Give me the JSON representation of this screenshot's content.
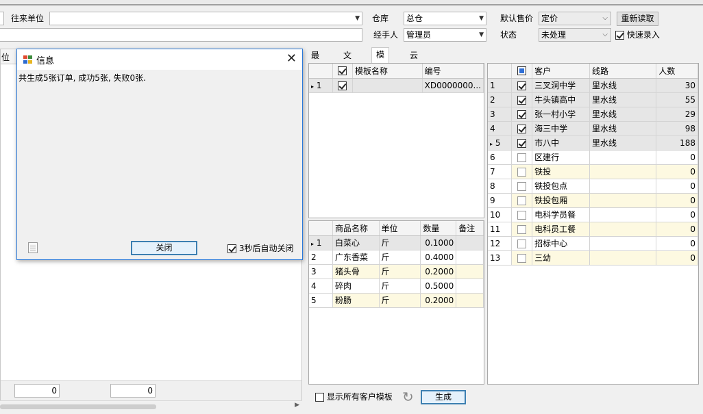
{
  "toolbar": {
    "counterparty_label": "往来单位",
    "counterparty_value": "",
    "warehouse_label": "仓库",
    "warehouse_value": "总仓",
    "default_price_label": "默认售价",
    "default_price_value": "定价",
    "reload_button": "重新读取",
    "handler_label": "经手人",
    "handler_value": "管理员",
    "status_label": "状态",
    "status_value": "未处理",
    "quick_entry_label": "快速录入",
    "quick_entry_checked": true,
    "left_partial_label": "位"
  },
  "dialog": {
    "title": "信息",
    "message": "共生成5张订单, 成功5张, 失败0张.",
    "close_button": "关闭",
    "auto_close_label": "3秒后自动关闭",
    "auto_close_checked": true
  },
  "left_panel": {
    "total_1": "0",
    "total_2": "0"
  },
  "tabs": [
    "最近",
    "文件",
    "模板",
    "云订单"
  ],
  "selected_tab": "模板",
  "templates": {
    "headers": [
      "模板名称",
      "编号"
    ],
    "rows": [
      {
        "indicator": "▸",
        "index": "1",
        "checked": true,
        "name": "",
        "code": "XD0000000..."
      }
    ]
  },
  "products": {
    "headers": [
      "商品名称",
      "单位",
      "数量",
      "备注"
    ],
    "rows": [
      {
        "index": "1",
        "name": "白菜心",
        "unit": "斤",
        "qty": "0.1000",
        "note": ""
      },
      {
        "index": "2",
        "name": "广东香菜",
        "unit": "斤",
        "qty": "0.4000",
        "note": ""
      },
      {
        "index": "3",
        "name": "猪头骨",
        "unit": "斤",
        "qty": "0.2000",
        "note": ""
      },
      {
        "index": "4",
        "name": "碎肉",
        "unit": "斤",
        "qty": "0.5000",
        "note": ""
      },
      {
        "index": "5",
        "name": "粉肠",
        "unit": "斤",
        "qty": "0.2000",
        "note": ""
      }
    ]
  },
  "customers": {
    "headers": [
      "客户",
      "线路",
      "人数"
    ],
    "rows": [
      {
        "index": "1",
        "checked": true,
        "name": "三叉洞中学",
        "route": "里水线",
        "count": "30"
      },
      {
        "index": "2",
        "checked": true,
        "name": "牛头镇高中",
        "route": "里水线",
        "count": "55"
      },
      {
        "index": "3",
        "checked": true,
        "name": "张一村小学",
        "route": "里水线",
        "count": "29"
      },
      {
        "index": "4",
        "checked": true,
        "name": "海三中学",
        "route": "里水线",
        "count": "98"
      },
      {
        "index": "5",
        "checked": true,
        "name": "市八中",
        "route": "里水线",
        "count": "188"
      },
      {
        "index": "6",
        "checked": false,
        "name": "区建行",
        "route": "",
        "count": "0"
      },
      {
        "index": "7",
        "checked": false,
        "name": "铁投",
        "route": "",
        "count": "0"
      },
      {
        "index": "8",
        "checked": false,
        "name": "铁投包点",
        "route": "",
        "count": "0"
      },
      {
        "index": "9",
        "checked": false,
        "name": "铁投包厢",
        "route": "",
        "count": "0"
      },
      {
        "index": "10",
        "checked": false,
        "name": "电科学员餐",
        "route": "",
        "count": "0"
      },
      {
        "index": "11",
        "checked": false,
        "name": "电科员工餐",
        "route": "",
        "count": "0"
      },
      {
        "index": "12",
        "checked": false,
        "name": "招标中心",
        "route": "",
        "count": "0"
      },
      {
        "index": "13",
        "checked": false,
        "name": "三幼",
        "route": "",
        "count": "0"
      }
    ]
  },
  "bottom": {
    "show_all_label": "显示所有客户模板",
    "show_all_checked": false,
    "generate_button": "生成"
  }
}
